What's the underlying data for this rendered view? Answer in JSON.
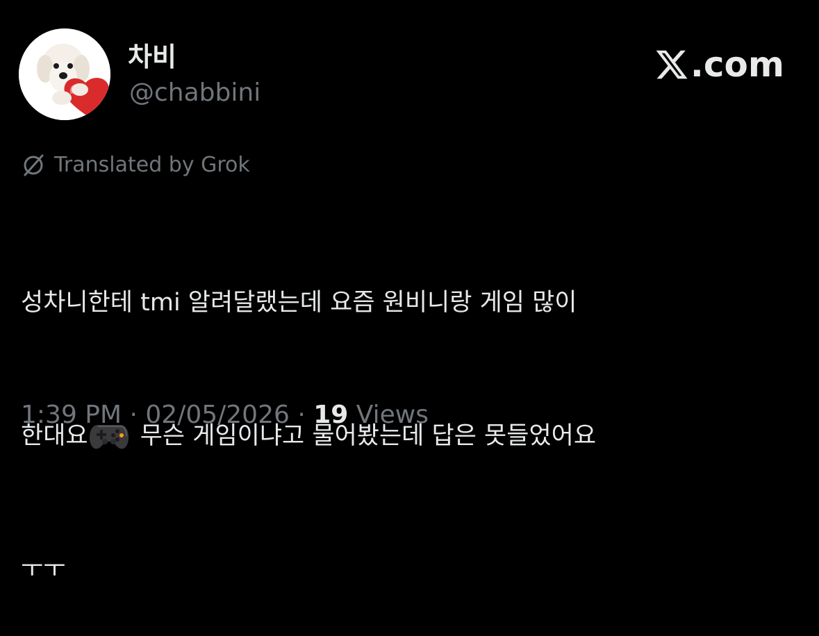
{
  "profile": {
    "display_name": "차비",
    "handle": "@chabbini"
  },
  "brand": {
    "logo_icon": "x-logo-icon",
    "domain_text": ".com"
  },
  "translation": {
    "icon": "grok-icon",
    "label": "Translated by Grok"
  },
  "tweet": {
    "line1": "성차니한테 tmi 알려달랬는데 요즘 원비니랑 게임 많이",
    "line2_before": "한대요",
    "line2_emoji": "video-game-controller-emoji",
    "line2_after": " 무슨 게임이냐고 물어봤는데 답은 못들었어요",
    "line3": "ㅜㅜ"
  },
  "meta": {
    "time": "1:39 PM",
    "sep1": " · ",
    "date": "02/05/2026",
    "sep2": " · ",
    "views_count": "19",
    "views_label": " Views"
  },
  "colors": {
    "background": "#000000",
    "primary_text": "#e7e9ea",
    "secondary_text": "#71767b"
  }
}
